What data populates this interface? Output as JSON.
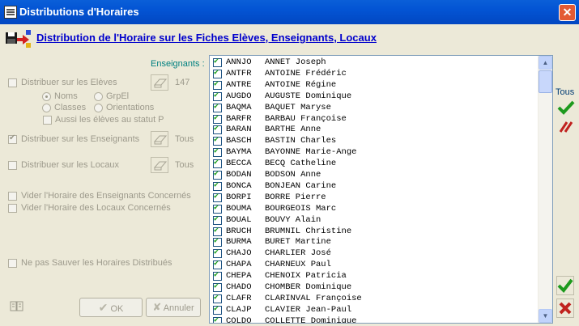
{
  "window": {
    "title": "Distributions d'Horaires",
    "close_label": "✕"
  },
  "header": {
    "title": "Distribution de l'Horaire sur les Fiches Elèves, Enseignants, Locaux"
  },
  "left": {
    "distribuer_eleves": {
      "label": "Distribuer sur les Elèves",
      "count": "147",
      "checked": false
    },
    "options": {
      "noms": "Noms",
      "grpel": "GrpEl",
      "classes": "Classes",
      "orientations": "Orientations",
      "statut_p": "Aussi les élèves au statut P"
    },
    "distribuer_enseignants": {
      "label": "Distribuer sur les Enseignants",
      "scope": "Tous",
      "checked": true
    },
    "distribuer_locaux": {
      "label": "Distribuer sur les Locaux",
      "scope": "Tous",
      "checked": false
    },
    "vider_enseignants": "Vider l'Horaire des Enseignants Concernés",
    "vider_locaux": "Vider l'Horaire des Locaux Concernés",
    "ne_pas_sauver": "Ne pas Sauver les Horaires Distribués",
    "ok_label": "OK",
    "annuler_label": "Annuler"
  },
  "enseignants": {
    "label": "Enseignants :",
    "rows": [
      {
        "code": "ANNJO",
        "name": "ANNET Joseph"
      },
      {
        "code": "ANTFR",
        "name": "ANTOINE Frédéric"
      },
      {
        "code": "ANTRE",
        "name": "ANTOINE Régine"
      },
      {
        "code": "AUGDO",
        "name": "AUGUSTE Dominique"
      },
      {
        "code": "BAQMA",
        "name": "BAQUET Maryse"
      },
      {
        "code": "BARFR",
        "name": "BARBAU Françoise"
      },
      {
        "code": "BARAN",
        "name": "BARTHE Anne"
      },
      {
        "code": "BASCH",
        "name": "BASTIN Charles"
      },
      {
        "code": "BAYMA",
        "name": "BAYONNE Marie-Ange"
      },
      {
        "code": "BECCA",
        "name": "BECQ Catheline"
      },
      {
        "code": "BODAN",
        "name": "BODSON Anne"
      },
      {
        "code": "BONCA",
        "name": "BONJEAN Carine"
      },
      {
        "code": "BORPI",
        "name": "BORRE Pierre"
      },
      {
        "code": "BOUMA",
        "name": "BOURGEOIS Marc"
      },
      {
        "code": "BOUAL",
        "name": "BOUVY Alain"
      },
      {
        "code": "BRUCH",
        "name": "BRUMNIL Christine"
      },
      {
        "code": "BURMA",
        "name": "BURET Martine"
      },
      {
        "code": "CHAJO",
        "name": "CHARLIER José"
      },
      {
        "code": "CHAPA",
        "name": "CHARNEUX Paul"
      },
      {
        "code": "CHEPA",
        "name": "CHENOIX Patricia"
      },
      {
        "code": "CHADO",
        "name": "CHOMBER Dominique"
      },
      {
        "code": "CLAFR",
        "name": "CLARINVAL Françoise"
      },
      {
        "code": "CLAJP",
        "name": "CLAVIER Jean-Paul"
      },
      {
        "code": "COLDO",
        "name": "COLLETTE Dominique"
      }
    ]
  },
  "right": {
    "tous_label": "Tous"
  },
  "colors": {
    "accent_blue": "#0000cc",
    "check_green": "#21a121",
    "cancel_red": "#c0221e",
    "label_teal": "#008080"
  },
  "icons": [
    "app-icon",
    "distribution-icon",
    "eraser-icon",
    "check-icon",
    "uncheck-all-icon",
    "cancel-icon",
    "book-icon"
  ]
}
